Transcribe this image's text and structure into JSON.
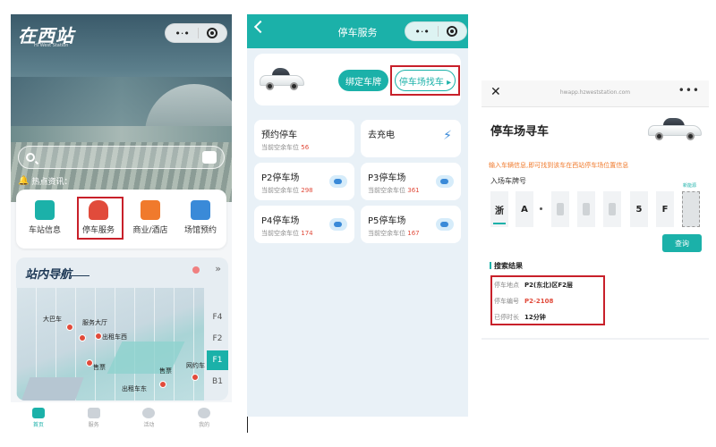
{
  "screen1": {
    "logo": "在西站",
    "logo_sub": "Hi West Station",
    "capsule_menu": "•·•",
    "hot_news_label": "热点资讯：",
    "functions": [
      {
        "label": "车站信息",
        "icon": "station-info-icon",
        "color": "#1bb1a9"
      },
      {
        "label": "停车服务",
        "icon": "parking-car-icon",
        "color": "#e14b3b"
      },
      {
        "label": "商业/酒店",
        "icon": "shop-hotel-icon",
        "color": "#f07a2c"
      },
      {
        "label": "场馆预约",
        "icon": "venue-booking-icon",
        "color": "#3a8ad8"
      }
    ],
    "nav_title": "站内导航",
    "nav_more": "»",
    "map_pois": [
      "大巴车",
      "服务大厅",
      "出租车西",
      "售票",
      "售票",
      "网约车",
      "出租车东"
    ],
    "floors": [
      "F4",
      "F2",
      "F1",
      "B1"
    ],
    "active_floor": "F1",
    "tabs": [
      {
        "label": "首页",
        "icon": "home-icon"
      },
      {
        "label": "服务",
        "icon": "service-icon"
      },
      {
        "label": "活动",
        "icon": "activity-icon"
      },
      {
        "label": "我的",
        "icon": "profile-icon"
      }
    ],
    "active_tab": "首页"
  },
  "screen2": {
    "title": "停车服务",
    "capsule_menu": "•·•",
    "bind_plate_btn": "绑定车牌",
    "find_car_btn": "停车场找车 ▸",
    "spot_label": "当前空余车位",
    "cells": [
      {
        "title": "预约停车",
        "count": "56",
        "kind": "none"
      },
      {
        "title": "去充电",
        "count": "",
        "kind": "bolt"
      },
      {
        "title": "P2停车场",
        "count": "298",
        "kind": "go"
      },
      {
        "title": "P3停车场",
        "count": "361",
        "kind": "go"
      },
      {
        "title": "P4停车场",
        "count": "174",
        "kind": "go"
      },
      {
        "title": "P5停车场",
        "count": "167",
        "kind": "go"
      }
    ]
  },
  "screen3": {
    "close": "✕",
    "url": "hwapp.hzweststation.com",
    "more": "•••",
    "title": "停车场寻车",
    "hint": "输入车辆信息,即可找到该车在西站停车场位置信息",
    "plate_label": "入场车牌号",
    "plate": [
      "浙",
      "A",
      "",
      "",
      "",
      "5",
      "F",
      ""
    ],
    "new_energy_label": "新能源",
    "query_btn": "查询",
    "result_title": "搜索结果",
    "results": [
      {
        "label": "停车地点",
        "value": "P2(东北)区F2层",
        "highlight": false
      },
      {
        "label": "停车编号",
        "value": "P2-2108",
        "highlight": true
      },
      {
        "label": "已停时长",
        "value": "12分钟",
        "highlight": false
      }
    ]
  },
  "colors": {
    "accent": "#1bb1a9",
    "highlight_box": "#c8202a",
    "count_red": "#e14b3b",
    "hint_orange": "#f07a2c"
  }
}
